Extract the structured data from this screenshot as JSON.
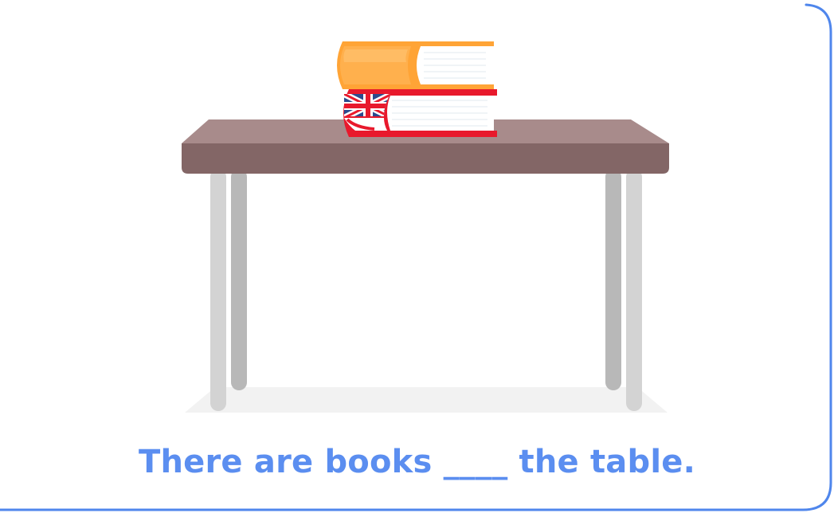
{
  "colors": {
    "frame": "#4f86ec",
    "caption": "#5b8ef0",
    "table_top": "#836666",
    "table_top_light": "#a88b8b",
    "table_leg_front": "#d3d3d3",
    "table_leg_back": "#b8b8b8",
    "floor_shadow": "#f2f2f2",
    "book_orange": "#ffa436",
    "book_red": "#e8192c",
    "book_flag_blue": "#2b4a8e"
  },
  "illustration": {
    "objects": [
      "table",
      "orange-book",
      "union-jack-book"
    ]
  },
  "exercise": {
    "sentence_start": "There are books ",
    "blank": "____",
    "sentence_end": " the table."
  }
}
